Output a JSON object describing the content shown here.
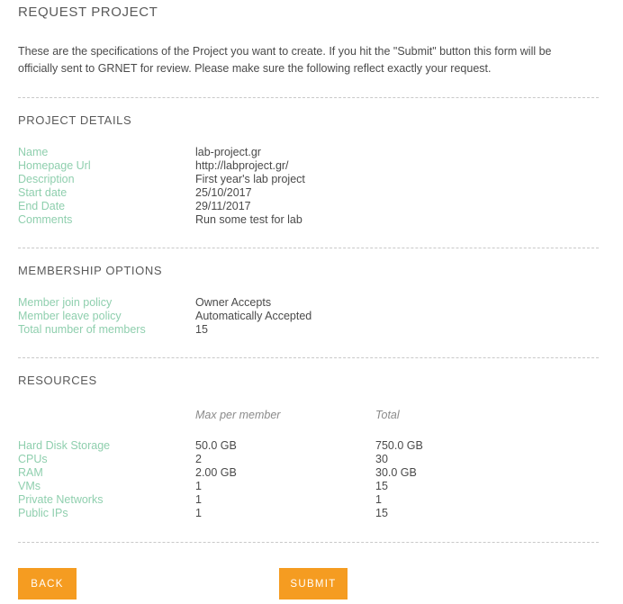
{
  "header": {
    "title": "REQUEST PROJECT",
    "intro": "These are the specifications of the Project you want to create. If you hit the \"Submit\" button this form will be officially sent to GRNET for review. Please make sure the following reflect exactly your request."
  },
  "project_details": {
    "title": "PROJECT DETAILS",
    "rows": [
      {
        "label": "Name",
        "value": "lab-project.gr"
      },
      {
        "label": "Homepage Url",
        "value": "http://labproject.gr/"
      },
      {
        "label": "Description",
        "value": "First year's lab project"
      },
      {
        "label": "Start date",
        "value": "25/10/2017"
      },
      {
        "label": "End Date",
        "value": "29/11/2017"
      },
      {
        "label": "Comments",
        "value": "Run some test for lab"
      }
    ]
  },
  "membership_options": {
    "title": "MEMBERSHIP OPTIONS",
    "rows": [
      {
        "label": "Member join policy",
        "value": "Owner Accepts"
      },
      {
        "label": "Member leave policy",
        "value": "Automatically Accepted"
      },
      {
        "label": "Total number of members",
        "value": "15"
      }
    ]
  },
  "resources": {
    "title": "RESOURCES",
    "columns": {
      "max_per_member": "Max per member",
      "total": "Total"
    },
    "rows": [
      {
        "name": "Hard Disk Storage",
        "max": "50.0 GB",
        "total": "750.0 GB"
      },
      {
        "name": "CPUs",
        "max": "2",
        "total": "30"
      },
      {
        "name": "RAM",
        "max": "2.00 GB",
        "total": "30.0 GB"
      },
      {
        "name": "VMs",
        "max": "1",
        "total": "15"
      },
      {
        "name": "Private Networks",
        "max": "1",
        "total": "1"
      },
      {
        "name": "Public IPs",
        "max": "1",
        "total": "15"
      }
    ]
  },
  "actions": {
    "back_label": "BACK",
    "submit_label": "SUBMIT"
  },
  "colors": {
    "label_teal": "#8fcfae",
    "button_orange": "#f59c21",
    "text": "#4a4a4a",
    "divider": "#c9c9c9"
  }
}
